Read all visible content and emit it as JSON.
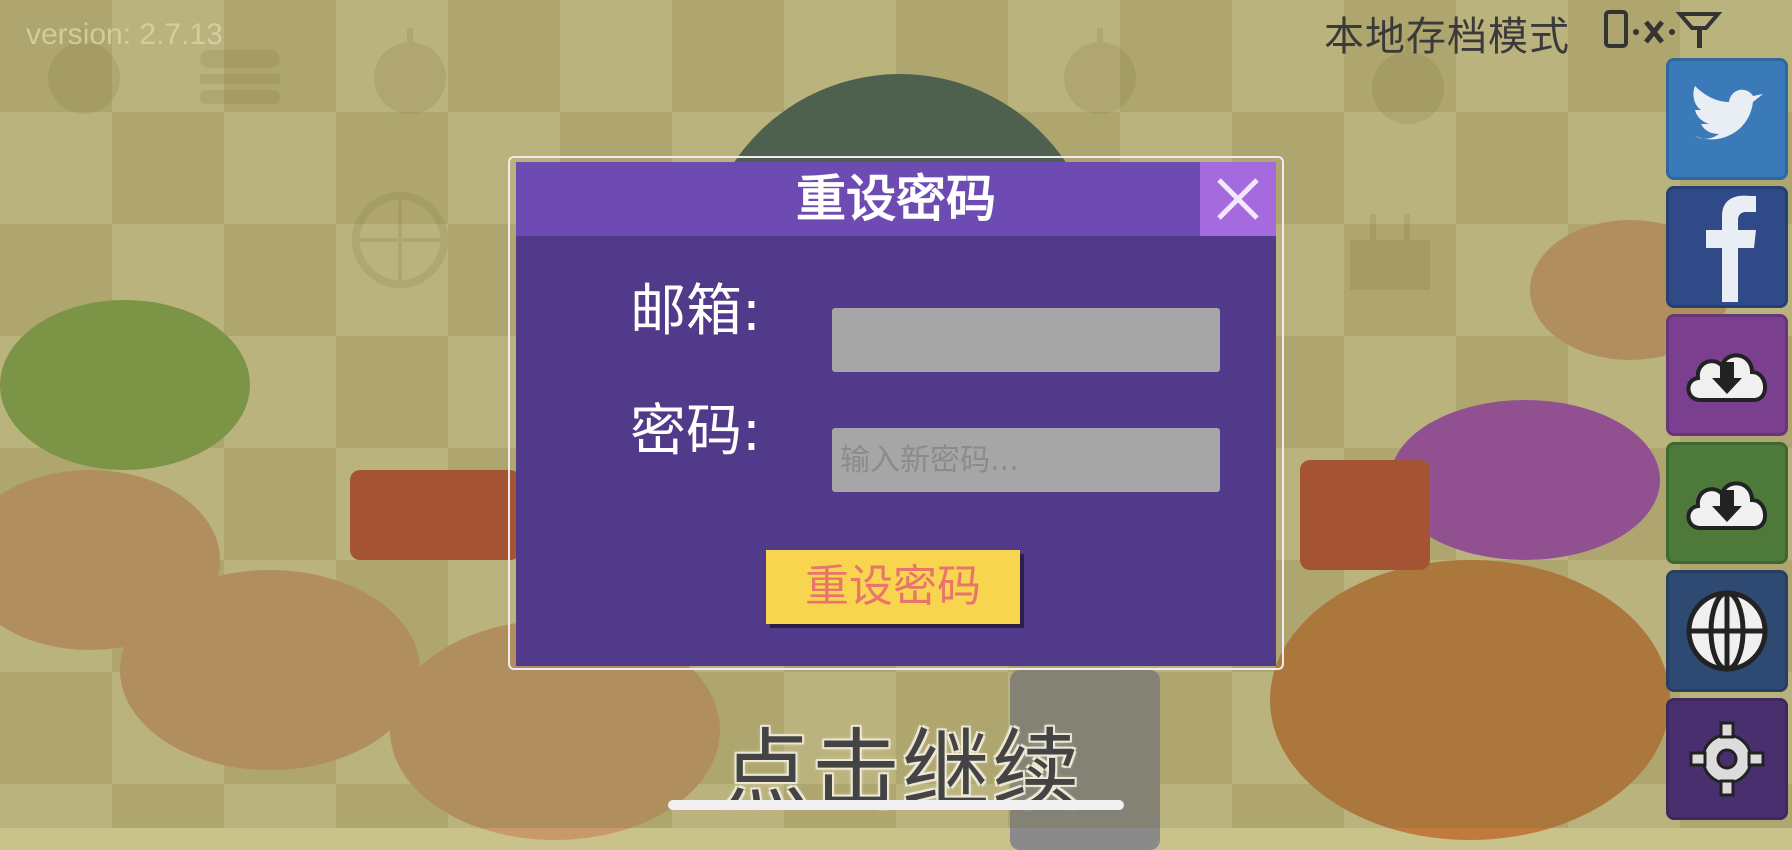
{
  "version_text": "version: 2.7.13",
  "storage_mode": "本地存档模式",
  "status_icons": [
    "phone-icon",
    "no-network-icon",
    "signal-icon"
  ],
  "side_buttons": [
    {
      "name": "twitter-button",
      "icon": "twitter-icon",
      "color": "#3a7ab8"
    },
    {
      "name": "facebook-button",
      "icon": "facebook-icon",
      "color": "#2f4a86"
    },
    {
      "name": "download-button-1",
      "icon": "cloud-download-icon",
      "color": "#7a3f8e"
    },
    {
      "name": "download-button-2",
      "icon": "cloud-download-icon",
      "color": "#4d7a3a"
    },
    {
      "name": "language-button",
      "icon": "globe-icon",
      "color": "#2e4a73"
    },
    {
      "name": "settings-button",
      "icon": "gear-icon",
      "color": "#4a2f6e"
    }
  ],
  "tap_to_continue": "点击继续",
  "dialog": {
    "title": "重设密码",
    "email_label": "邮箱:",
    "email_value": "",
    "password_label": "密码:",
    "password_placeholder": "输入新密码...",
    "submit_label": "重设密码",
    "colors": {
      "body": "#523a8a",
      "header": "#6d4bb3",
      "close": "#a56bde",
      "button": "#f7d54e",
      "button_text": "#e8746b"
    }
  }
}
